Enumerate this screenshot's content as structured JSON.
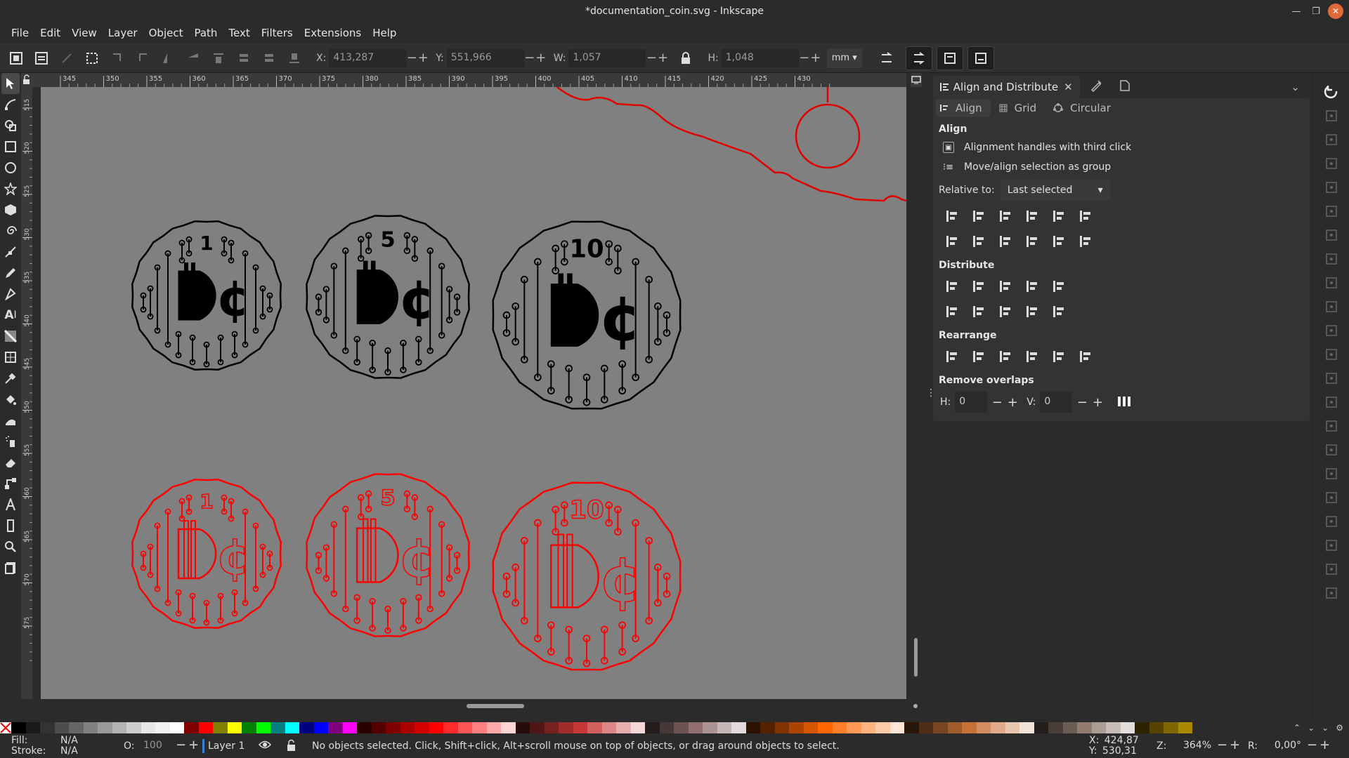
{
  "window": {
    "title": "*documentation_coin.svg - Inkscape"
  },
  "menu": [
    "File",
    "Edit",
    "View",
    "Layer",
    "Object",
    "Path",
    "Text",
    "Filters",
    "Extensions",
    "Help"
  ],
  "toolbar": {
    "x_label": "X:",
    "x_value": "413,287",
    "y_label": "Y:",
    "y_value": "551,966",
    "w_label": "W:",
    "w_value": "1,057",
    "h_label": "H:",
    "h_value": "1,048",
    "unit": "mm"
  },
  "rulers": {
    "h_ticks": [
      "345",
      "350",
      "355",
      "360",
      "365",
      "370",
      "375",
      "380",
      "385",
      "390",
      "395",
      "400",
      "405",
      "410",
      "415",
      "420",
      "425",
      "430"
    ],
    "v_ticks": [
      "515",
      "520",
      "525",
      "530",
      "535",
      "540",
      "545",
      "550",
      "555",
      "560",
      "565",
      "570",
      "575"
    ]
  },
  "coins": [
    {
      "label": "1",
      "color": "#000000"
    },
    {
      "label": "5",
      "color": "#000000"
    },
    {
      "label": "10",
      "color": "#000000"
    },
    {
      "label": "1",
      "color": "#ff0000"
    },
    {
      "label": "5",
      "color": "#ff0000"
    },
    {
      "label": "10",
      "color": "#ff0000"
    }
  ],
  "dialog": {
    "tab_title": "Align and Distribute",
    "subtabs": {
      "align": "Align",
      "grid": "Grid",
      "circular": "Circular"
    },
    "align_header": "Align",
    "opt_handles": "Alignment handles with third click",
    "opt_group": "Move/align selection as group",
    "relative_label": "Relative to:",
    "relative_value": "Last selected",
    "distribute_header": "Distribute",
    "rearrange_header": "Rearrange",
    "overlaps_header": "Remove overlaps",
    "h_label": "H:",
    "h_value": "0",
    "v_label": "V:",
    "v_value": "0"
  },
  "status": {
    "fill_label": "Fill:",
    "fill_value": "N/A",
    "stroke_label": "Stroke:",
    "stroke_value": "N/A",
    "opacity_label": "O:",
    "opacity_value": "100",
    "layer": "Layer 1",
    "message": "No objects selected. Click, Shift+click, Alt+scroll mouse on top of objects, or drag around objects to select.",
    "cx_label": "X:",
    "cx_value": "424,87",
    "cy_label": "Y:",
    "cy_value": "530,31",
    "zoom_label": "Z:",
    "zoom_value": "364%",
    "rot_label": "R:",
    "rot_value": "0,00°"
  },
  "palette_colors": [
    "#000000",
    "#1a1a1a",
    "#333333",
    "#4d4d4d",
    "#666666",
    "#808080",
    "#999999",
    "#b3b3b3",
    "#cccccc",
    "#e6e6e6",
    "#f2f2f2",
    "#ffffff",
    "#800000",
    "#ff0000",
    "#808000",
    "#ffff00",
    "#008000",
    "#00ff00",
    "#008080",
    "#00ffff",
    "#000080",
    "#0000ff",
    "#800080",
    "#ff00ff",
    "#2b0000",
    "#550000",
    "#800000",
    "#aa0000",
    "#d40000",
    "#ff0000",
    "#ff2a2a",
    "#ff5555",
    "#ff8080",
    "#ffaaaa",
    "#ffd5d5",
    "#280b0b",
    "#501616",
    "#782121",
    "#a02c2c",
    "#c83737",
    "#d35f5f",
    "#de8787",
    "#e9afaf",
    "#f4d7d7",
    "#241c1c",
    "#483737",
    "#6c5353",
    "#916f6f",
    "#ac9393",
    "#c8b7b7",
    "#e3dbdb",
    "#2b1100",
    "#552200",
    "#803300",
    "#aa4400",
    "#d45500",
    "#ff6600",
    "#ff7f2a",
    "#ff9955",
    "#ffb380",
    "#ffccaa",
    "#ffe6d5",
    "#28170b",
    "#502d16",
    "#784421",
    "#a05a2c",
    "#c87137",
    "#d38d5f",
    "#deaa87",
    "#e9c6af",
    "#f4e3d7",
    "#241f1c",
    "#483e37",
    "#6c5d53",
    "#917c6f",
    "#ac9d93",
    "#c8beb7",
    "#e3dedb",
    "#2b2200",
    "#554400",
    "#806600",
    "#aa8800"
  ]
}
